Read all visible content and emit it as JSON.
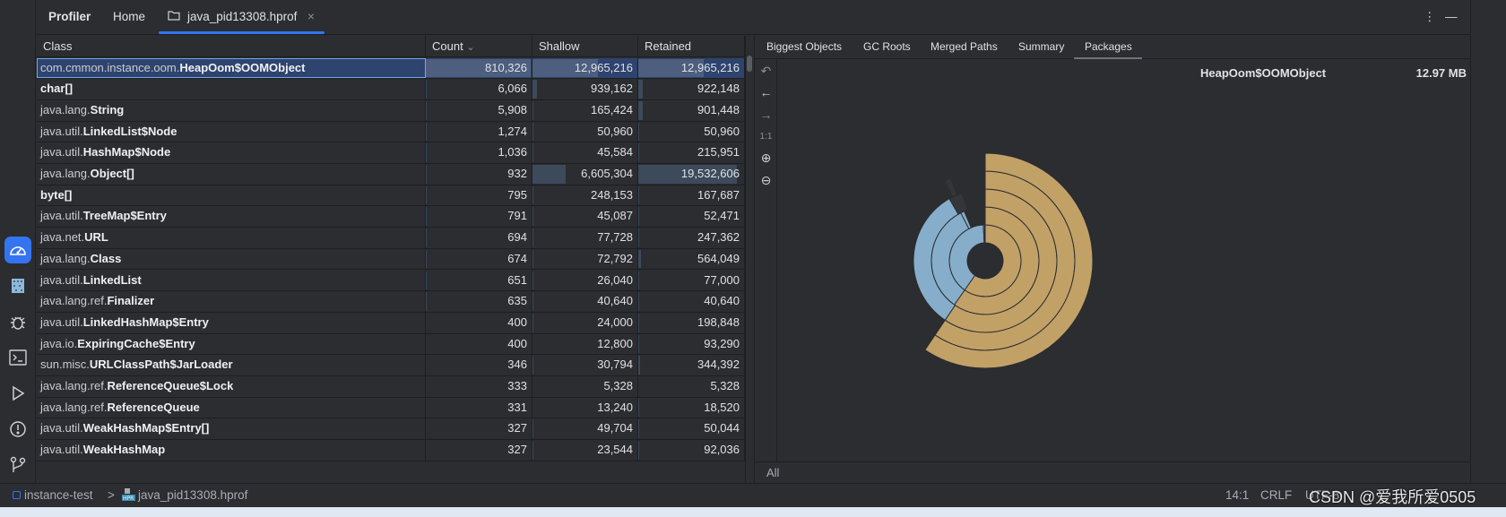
{
  "topbar": {
    "tabs": [
      {
        "label": "Profiler"
      },
      {
        "label": "Home"
      },
      {
        "label": "java_pid13308.hprof",
        "icon": "folder-icon",
        "closable": true,
        "active": true
      }
    ],
    "close_glyph": "×",
    "more_glyph": "⋮",
    "minimize_glyph": "—"
  },
  "sidebar": {
    "items": [
      {
        "icon": "profiler-gauge-icon",
        "active": true
      },
      {
        "icon": "hprof-file-icon"
      },
      {
        "icon": "bug-icon"
      },
      {
        "icon": "terminal-icon"
      },
      {
        "icon": "run-icon"
      },
      {
        "icon": "problems-icon"
      },
      {
        "icon": "git-branch-icon"
      }
    ]
  },
  "table": {
    "columns": [
      "Class",
      "Count",
      "Shallow",
      "Retained"
    ],
    "sort_indicator": "⌄",
    "rows": [
      {
        "pkg": "com.cmmon.instance.oom.",
        "name": "HeapOom$OOMObject",
        "count": "810,326",
        "shallow": "12,965,216",
        "retained": "12,965,216",
        "selected": true
      },
      {
        "pkg": "",
        "name": "char[]",
        "count": "6,066",
        "shallow": "939,162",
        "retained": "922,148"
      },
      {
        "pkg": "java.lang.",
        "name": "String",
        "count": "5,908",
        "shallow": "165,424",
        "retained": "901,448"
      },
      {
        "pkg": "java.util.",
        "name": "LinkedList$Node",
        "count": "1,274",
        "shallow": "50,960",
        "retained": "50,960"
      },
      {
        "pkg": "java.util.",
        "name": "HashMap$Node",
        "count": "1,036",
        "shallow": "45,584",
        "retained": "215,951"
      },
      {
        "pkg": "java.lang.",
        "name": "Object[]",
        "count": "932",
        "shallow": "6,605,304",
        "retained": "19,532,606"
      },
      {
        "pkg": "",
        "name": "byte[]",
        "count": "795",
        "shallow": "248,153",
        "retained": "167,687"
      },
      {
        "pkg": "java.util.",
        "name": "TreeMap$Entry",
        "count": "791",
        "shallow": "45,087",
        "retained": "52,471"
      },
      {
        "pkg": "java.net.",
        "name": "URL",
        "count": "694",
        "shallow": "77,728",
        "retained": "247,362"
      },
      {
        "pkg": "java.lang.",
        "name": "Class",
        "count": "674",
        "shallow": "72,792",
        "retained": "564,049"
      },
      {
        "pkg": "java.util.",
        "name": "LinkedList",
        "count": "651",
        "shallow": "26,040",
        "retained": "77,000"
      },
      {
        "pkg": "java.lang.ref.",
        "name": "Finalizer",
        "count": "635",
        "shallow": "40,640",
        "retained": "40,640"
      },
      {
        "pkg": "java.util.",
        "name": "LinkedHashMap$Entry",
        "count": "400",
        "shallow": "24,000",
        "retained": "198,848"
      },
      {
        "pkg": "java.io.",
        "name": "ExpiringCache$Entry",
        "count": "400",
        "shallow": "12,800",
        "retained": "93,290"
      },
      {
        "pkg": "sun.misc.",
        "name": "URLClassPath$JarLoader",
        "count": "346",
        "shallow": "30,794",
        "retained": "344,392"
      },
      {
        "pkg": "java.lang.ref.",
        "name": "ReferenceQueue$Lock",
        "count": "333",
        "shallow": "5,328",
        "retained": "5,328"
      },
      {
        "pkg": "java.lang.ref.",
        "name": "ReferenceQueue",
        "count": "331",
        "shallow": "13,240",
        "retained": "18,520"
      },
      {
        "pkg": "java.util.",
        "name": "WeakHashMap$Entry[]",
        "count": "327",
        "shallow": "49,704",
        "retained": "50,044"
      },
      {
        "pkg": "java.util.",
        "name": "WeakHashMap",
        "count": "327",
        "shallow": "23,544",
        "retained": "92,036"
      }
    ]
  },
  "right_panel": {
    "tabs": [
      {
        "label": "Biggest Objects"
      },
      {
        "label": "GC Roots"
      },
      {
        "label": "Merged Paths"
      },
      {
        "label": "Summary"
      },
      {
        "label": "Packages",
        "active": true
      }
    ],
    "tools": [
      {
        "icon": "undo-icon",
        "glyph": "↶"
      },
      {
        "icon": "back-arrow-icon",
        "glyph": "←"
      },
      {
        "icon": "forward-arrow-icon",
        "glyph": "→"
      },
      {
        "icon": "actual-size-icon",
        "glyph": "1:1"
      },
      {
        "icon": "zoom-in-icon",
        "glyph": "⊕"
      },
      {
        "icon": "zoom-out-icon",
        "glyph": "⊖"
      }
    ],
    "hover_name": "HeapOom$OOMObject",
    "hover_size": "12.97 MB",
    "footer": "All",
    "sunburst": {
      "colors": {
        "gold": "#c2a167",
        "blue": "#86aecb",
        "dark": "#35363a"
      },
      "rings": [
        [
          {
            "c": "gold",
            "from": 0,
            "to": 215
          },
          {
            "c": "blue",
            "from": 215,
            "to": 357
          },
          {
            "c": "blue",
            "from": 357,
            "to": 359
          }
        ],
        [
          {
            "c": "gold",
            "from": 0,
            "to": 215
          },
          {
            "c": "blue",
            "from": 215,
            "to": 333
          },
          {
            "c": "blue",
            "from": 333,
            "to": 337
          }
        ],
        [
          {
            "c": "gold",
            "from": 0,
            "to": 214
          },
          {
            "c": "blue",
            "from": 214,
            "to": 330
          },
          {
            "c": "dark",
            "from": 330,
            "to": 341
          }
        ],
        [
          {
            "c": "gold",
            "from": 0,
            "to": 214
          },
          {
            "c": "dark",
            "from": 333,
            "to": 337
          }
        ],
        [
          {
            "c": "gold",
            "from": 0,
            "to": 214
          }
        ]
      ]
    }
  },
  "status": {
    "project": "instance-test",
    "separator": ">",
    "file": "java_pid13308.hprof",
    "position": "14:1",
    "line_ending": "CRLF",
    "encoding": "UTF-8"
  },
  "watermark": "CSDN @爱我所爱0505"
}
